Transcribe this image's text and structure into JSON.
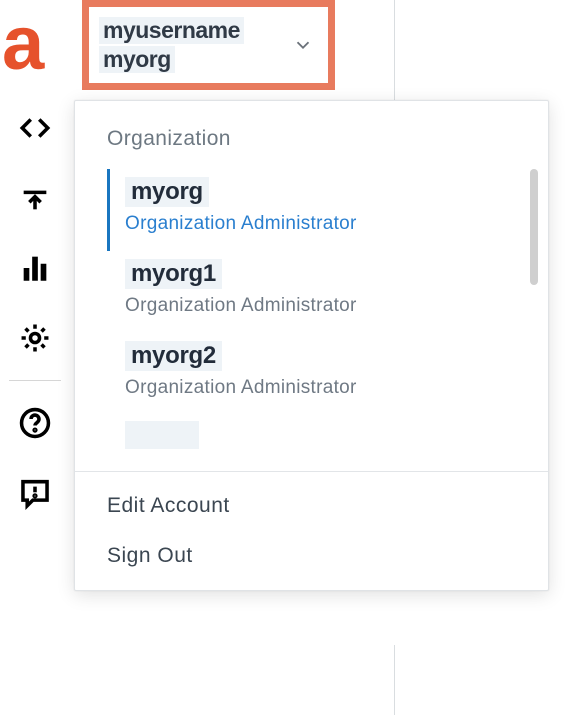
{
  "logo": {
    "letter": "a"
  },
  "header": {
    "username": "myusername",
    "org": "myorg"
  },
  "dropdown": {
    "section_title": "Organization",
    "orgs": [
      {
        "name": "myorg",
        "role": "Organization Administrator",
        "selected": true
      },
      {
        "name": "myorg1",
        "role": "Organization Administrator",
        "selected": false
      },
      {
        "name": "myorg2",
        "role": "Organization Administrator",
        "selected": false
      }
    ],
    "actions": {
      "edit_account": "Edit Account",
      "sign_out": "Sign Out"
    }
  },
  "sidebar_icons": [
    "code",
    "upload",
    "chart",
    "gear",
    "help",
    "feedback"
  ]
}
